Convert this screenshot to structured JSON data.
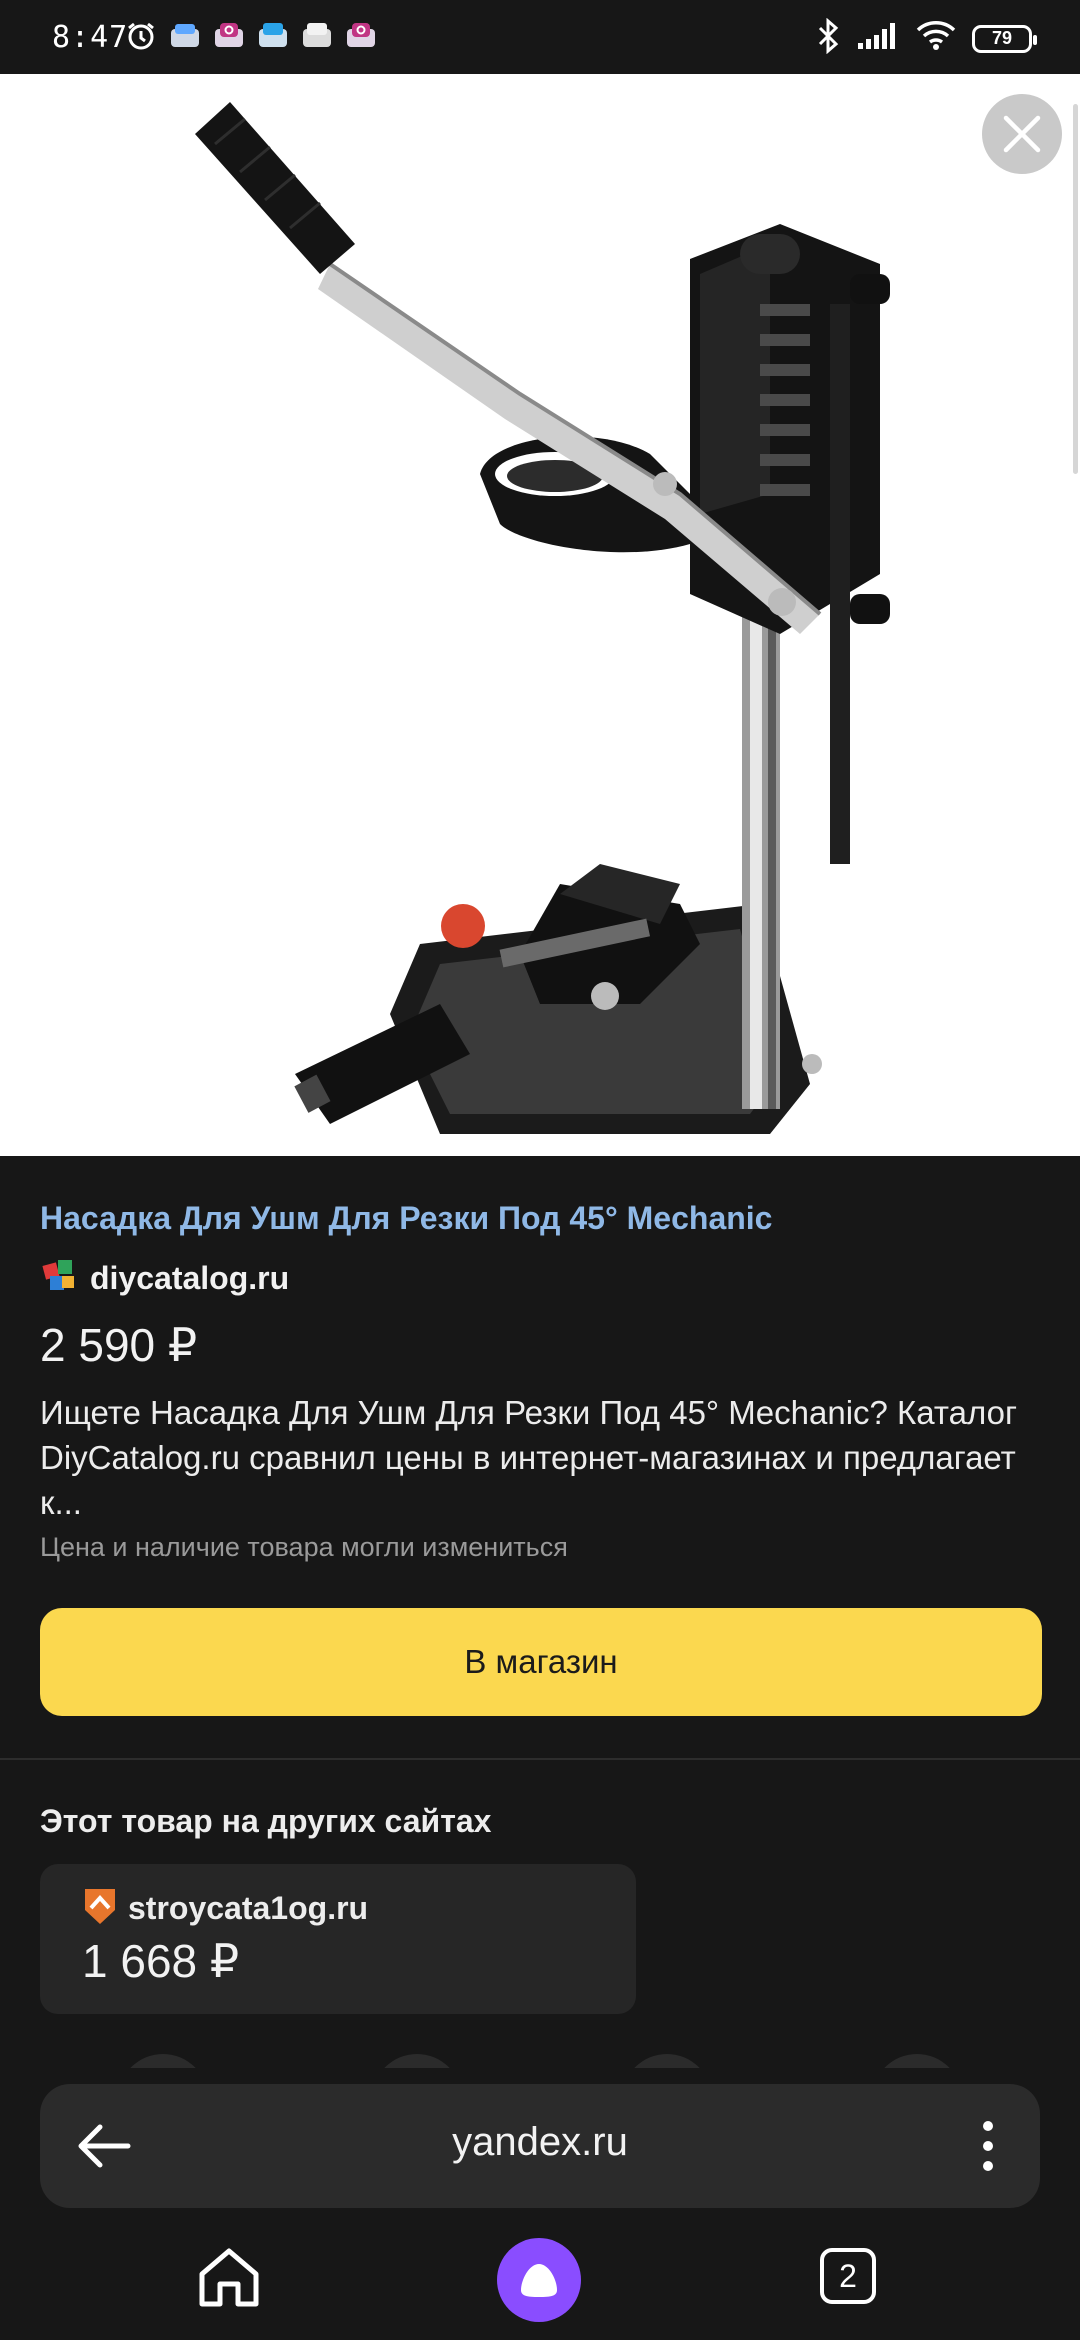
{
  "status_bar": {
    "time": "8:47",
    "battery": "79",
    "notification_icons": [
      "alarm-icon",
      "app-notification-icon",
      "instagram-icon",
      "app-notification-icon",
      "app-notification-icon",
      "instagram-icon"
    ]
  },
  "product": {
    "title": "Насадка Для Ушм Для Резки Под 45° Mechanic",
    "source": "diycatalog.ru",
    "price": "2 590 ₽",
    "description": "Ищете Насадка Для Ушм Для Резки Под 45° Mechanic? Каталог DiyCatalog.ru сравнил цены в интернет-магазинах и предлагает к...",
    "notice": "Цена и наличие товара могли измениться",
    "shop_button": "В магазин"
  },
  "other_sites": {
    "heading": "Этот товар на других сайтах",
    "offers": [
      {
        "source": "stroycata1og.ru",
        "price": "1 668 ₽"
      }
    ]
  },
  "browser": {
    "url": "yandex.ru",
    "tab_count": "2"
  },
  "colors": {
    "background": "#171717",
    "link_title": "#8fb8e6",
    "shop_button": "#fbd84f",
    "alice": "#8a4dff"
  }
}
